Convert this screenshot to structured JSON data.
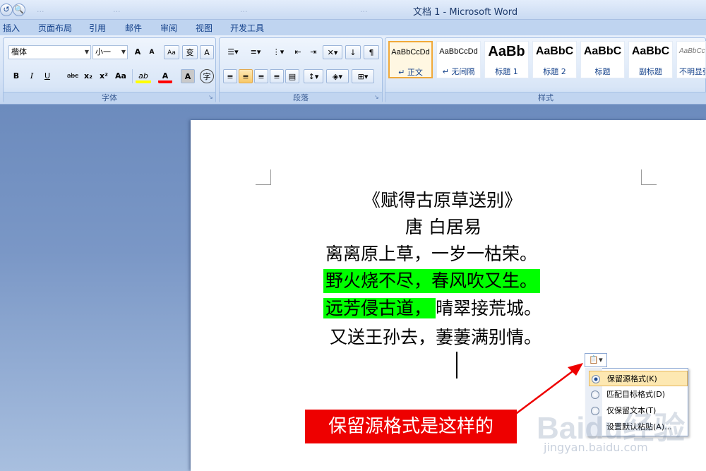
{
  "window": {
    "title": "文档 1 - Microsoft Word",
    "faded_tabs": [
      "...",
      "...",
      "...",
      "..."
    ]
  },
  "ribbon_tabs": [
    "插入",
    "页面布局",
    "引用",
    "邮件",
    "审阅",
    "视图",
    "开发工具"
  ],
  "font_group": {
    "label": "字体",
    "font_name": "楷体",
    "font_size": "小一",
    "buttons_row1": [
      "A",
      "A",
      "Aa",
      "变",
      "A"
    ],
    "buttons_row2": [
      "B",
      "I",
      "U",
      "abc",
      "x₂",
      "x²",
      "Aa",
      "ab",
      "A",
      "A",
      "字"
    ]
  },
  "paragraph_group": {
    "label": "段落"
  },
  "styles_group": {
    "label": "样式",
    "styles": [
      {
        "sample": "AaBbCcDd",
        "name": "↵ 正文"
      },
      {
        "sample": "AaBbCcDd",
        "name": "↵ 无间隔"
      },
      {
        "sample": "AaBb",
        "name": "标题 1"
      },
      {
        "sample": "AaBbC",
        "name": "标题 2"
      },
      {
        "sample": "AaBbC",
        "name": "标题"
      },
      {
        "sample": "AaBbC",
        "name": "副标题"
      },
      {
        "sample": "AaBbCcI",
        "name": "不明显强"
      }
    ]
  },
  "document": {
    "lines": [
      {
        "text": "《赋得古原草送别》",
        "highlight": false
      },
      {
        "text": "唐 白居易",
        "highlight": false
      },
      {
        "text": "离离原上草，一岁一枯荣。",
        "highlight": false
      },
      {
        "text": "野火烧不尽，春风吹又生。",
        "highlight": true
      },
      {
        "hl_part": "远芳侵古道，",
        "rest": "晴翠接荒城。"
      },
      {
        "text": "又送王孙去，萋萋满别情。",
        "highlight": false
      }
    ]
  },
  "paste_options": {
    "button_label": "📋▾",
    "items": [
      {
        "label": "保留源格式(K)",
        "selected": true
      },
      {
        "label": "匹配目标格式(D)",
        "selected": false
      },
      {
        "label": "仅保留文本(T)",
        "selected": false
      },
      {
        "label": "设置默认粘贴(A)...",
        "selected": false
      }
    ]
  },
  "annotation": {
    "text": "保留源格式是这样的",
    "color": "#ee0000"
  },
  "watermark": {
    "brand": "Baidu经验",
    "url": "jingyan.baidu.com"
  },
  "colors": {
    "highlight": "#00ff00",
    "ribbon": "#d5e3f6",
    "selected_style_border": "#f0a93a"
  }
}
